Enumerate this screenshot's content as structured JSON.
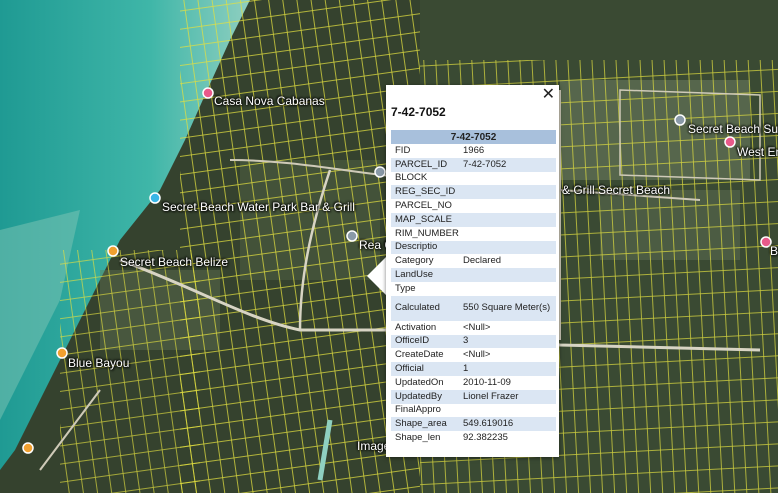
{
  "map_labels": [
    {
      "name": "casa-nova-label",
      "text": "Casa Nova Cabanas"
    },
    {
      "name": "water-park-label",
      "text": "Secret Beach Water Park Bar & Grill"
    },
    {
      "name": "secret-beach-belize-label",
      "text": "Secret Beach Belize"
    },
    {
      "name": "blue-bayou-label",
      "text": "Blue Bayou"
    },
    {
      "name": "secret-beach-subd-label",
      "text": "Secret Beach Subdi"
    },
    {
      "name": "west-end-label",
      "text": "West End"
    },
    {
      "name": "grill-secret-beach-label",
      "text": "& Grill Secret Beach"
    },
    {
      "name": "rea-label",
      "text": "Rea C"
    },
    {
      "name": "image-label",
      "text": "Image"
    },
    {
      "name": "b-label",
      "text": "B"
    }
  ],
  "popup": {
    "close": "✕",
    "title": "7-42-7052",
    "table_header": "7-42-7052",
    "rows": [
      {
        "key": "FID",
        "value": "1966"
      },
      {
        "key": "PARCEL_ID",
        "value": "7-42-7052"
      },
      {
        "key": "BLOCK",
        "value": ""
      },
      {
        "key": "REG_SEC_ID",
        "value": ""
      },
      {
        "key": "PARCEL_NO",
        "value": ""
      },
      {
        "key": "MAP_SCALE",
        "value": ""
      },
      {
        "key": "RIM_NUMBER",
        "value": ""
      },
      {
        "key": "Descriptio",
        "value": ""
      },
      {
        "key": "Category",
        "value": "Declared"
      },
      {
        "key": "LandUse",
        "value": ""
      },
      {
        "key": "Type",
        "value": ""
      },
      {
        "key": "Calculated",
        "value": "550 Square Meter(s)"
      },
      {
        "key": "Activation",
        "value": "<Null>"
      },
      {
        "key": "OfficeID",
        "value": "3"
      },
      {
        "key": "CreateDate",
        "value": "<Null>"
      },
      {
        "key": "Official",
        "value": "1"
      },
      {
        "key": "UpdatedOn",
        "value": "2010-11-09"
      },
      {
        "key": "UpdatedBy",
        "value": "Lionel Frazer"
      },
      {
        "key": "FinalAppro",
        "value": ""
      },
      {
        "key": "Shape_area",
        "value": "549.619016"
      },
      {
        "key": "Shape_len",
        "value": "92.382235"
      }
    ]
  }
}
